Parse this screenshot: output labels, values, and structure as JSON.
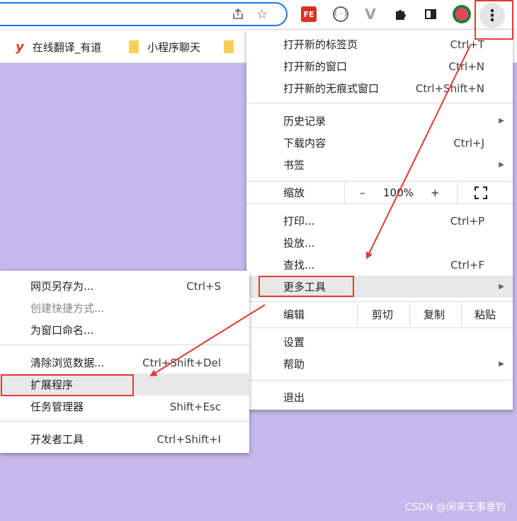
{
  "toolbar": {
    "ext_fe_label": "FE",
    "ext_circle_label": "{···}",
    "ext_v_label": "V",
    "menu_icon_label": "⋮"
  },
  "bookmarks": [
    {
      "label": "在线翻译_有道"
    },
    {
      "label": "小程序聊天"
    }
  ],
  "menu": {
    "new_tab": {
      "label": "打开新的标签页",
      "shortcut": "Ctrl+T"
    },
    "new_window": {
      "label": "打开新的窗口",
      "shortcut": "Ctrl+N"
    },
    "new_incognito": {
      "label": "打开新的无痕式窗口",
      "shortcut": "Ctrl+Shift+N"
    },
    "history": {
      "label": "历史记录"
    },
    "downloads": {
      "label": "下载内容",
      "shortcut": "Ctrl+J"
    },
    "bookmarks": {
      "label": "书签"
    },
    "zoom": {
      "label": "缩放",
      "minus": "–",
      "value": "100%",
      "plus": "+"
    },
    "print": {
      "label": "打印...",
      "shortcut": "Ctrl+P"
    },
    "cast": {
      "label": "投放..."
    },
    "find": {
      "label": "查找...",
      "shortcut": "Ctrl+F"
    },
    "more_tools": {
      "label": "更多工具"
    },
    "edit": {
      "label": "编辑",
      "cut": "剪切",
      "copy": "复制",
      "paste": "粘贴"
    },
    "settings": {
      "label": "设置"
    },
    "help": {
      "label": "帮助"
    },
    "exit": {
      "label": "退出"
    }
  },
  "submenu": {
    "save_page": {
      "label": "网页另存为...",
      "shortcut": "Ctrl+S"
    },
    "create_shortcut": {
      "label": "创建快捷方式..."
    },
    "name_window": {
      "label": "为窗口命名..."
    },
    "clear_data": {
      "label": "清除浏览数据...",
      "shortcut": "Ctrl+Shift+Del"
    },
    "extensions": {
      "label": "扩展程序"
    },
    "task_manager": {
      "label": "任务管理器",
      "shortcut": "Shift+Esc"
    },
    "dev_tools": {
      "label": "开发者工具",
      "shortcut": "Ctrl+Shift+I"
    }
  },
  "watermark": "CSDN @闲来无事垂钓",
  "colors": {
    "accent": "#1a73e8",
    "annotation": "#e53935",
    "page_bg": "#c6b8ec"
  }
}
